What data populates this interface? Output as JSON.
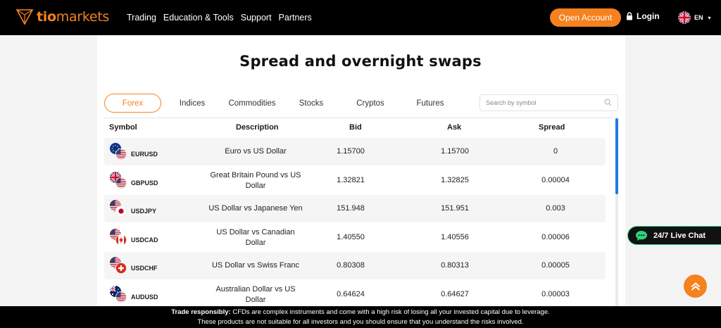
{
  "brand": {
    "name_part1": "tio",
    "name_part2": "markets",
    "accent": "#f5811f"
  },
  "nav": [
    {
      "label": "Trading"
    },
    {
      "label": "Education & Tools"
    },
    {
      "label": "Support"
    },
    {
      "label": "Partners"
    }
  ],
  "header": {
    "open_account": "Open Account",
    "login": "Login",
    "lang": "EN"
  },
  "page": {
    "title": "Spread and overnight swaps"
  },
  "tabs": [
    {
      "label": "Forex",
      "active": true
    },
    {
      "label": "Indices"
    },
    {
      "label": "Commodities"
    },
    {
      "label": "Stocks"
    },
    {
      "label": "Cryptos"
    },
    {
      "label": "Futures"
    }
  ],
  "search": {
    "placeholder": "Search by symbol"
  },
  "table": {
    "columns": [
      "Symbol",
      "Description",
      "Bid",
      "Ask",
      "Spread"
    ],
    "rows": [
      {
        "symbol": "EURUSD",
        "description": "Euro vs US Dollar",
        "bid": "1.15700",
        "ask": "1.15700",
        "spread": "0",
        "flags": [
          "eu-flag-icon",
          "us-flag-icon"
        ]
      },
      {
        "symbol": "GBPUSD",
        "description": "Great Britain Pound vs US Dollar",
        "bid": "1.32821",
        "ask": "1.32825",
        "spread": "0.00004",
        "flags": [
          "uk-flag-icon",
          "us-flag-icon"
        ]
      },
      {
        "symbol": "USDJPY",
        "description": "US Dollar vs Japanese Yen",
        "bid": "151.948",
        "ask": "151.951",
        "spread": "0.003",
        "flags": [
          "us-flag-icon",
          "jp-flag-icon"
        ]
      },
      {
        "symbol": "USDCAD",
        "description": "US Dollar vs Canadian Dollar",
        "bid": "1.40550",
        "ask": "1.40556",
        "spread": "0.00006",
        "flags": [
          "us-flag-icon",
          "ca-flag-icon"
        ]
      },
      {
        "symbol": "USDCHF",
        "description": "US Dollar vs Swiss Franc",
        "bid": "0.80308",
        "ask": "0.80313",
        "spread": "0.00005",
        "flags": [
          "us-flag-icon",
          "ch-flag-icon"
        ]
      },
      {
        "symbol": "AUDUSD",
        "description": "Australian Dollar vs US Dollar",
        "bid": "0.64624",
        "ask": "0.64627",
        "spread": "0.00003",
        "flags": [
          "au-flag-icon",
          "us-flag-icon"
        ]
      }
    ]
  },
  "chat": {
    "label": "24/7 Live Chat"
  },
  "footer": {
    "bold": "Trade responsibly:",
    "line1": " CFDs are complex instruments and come with a high risk of losing all your invested capital due to leverage.",
    "line2": "These products are not suitable for all investors and you should ensure that you understand the risks involved."
  }
}
